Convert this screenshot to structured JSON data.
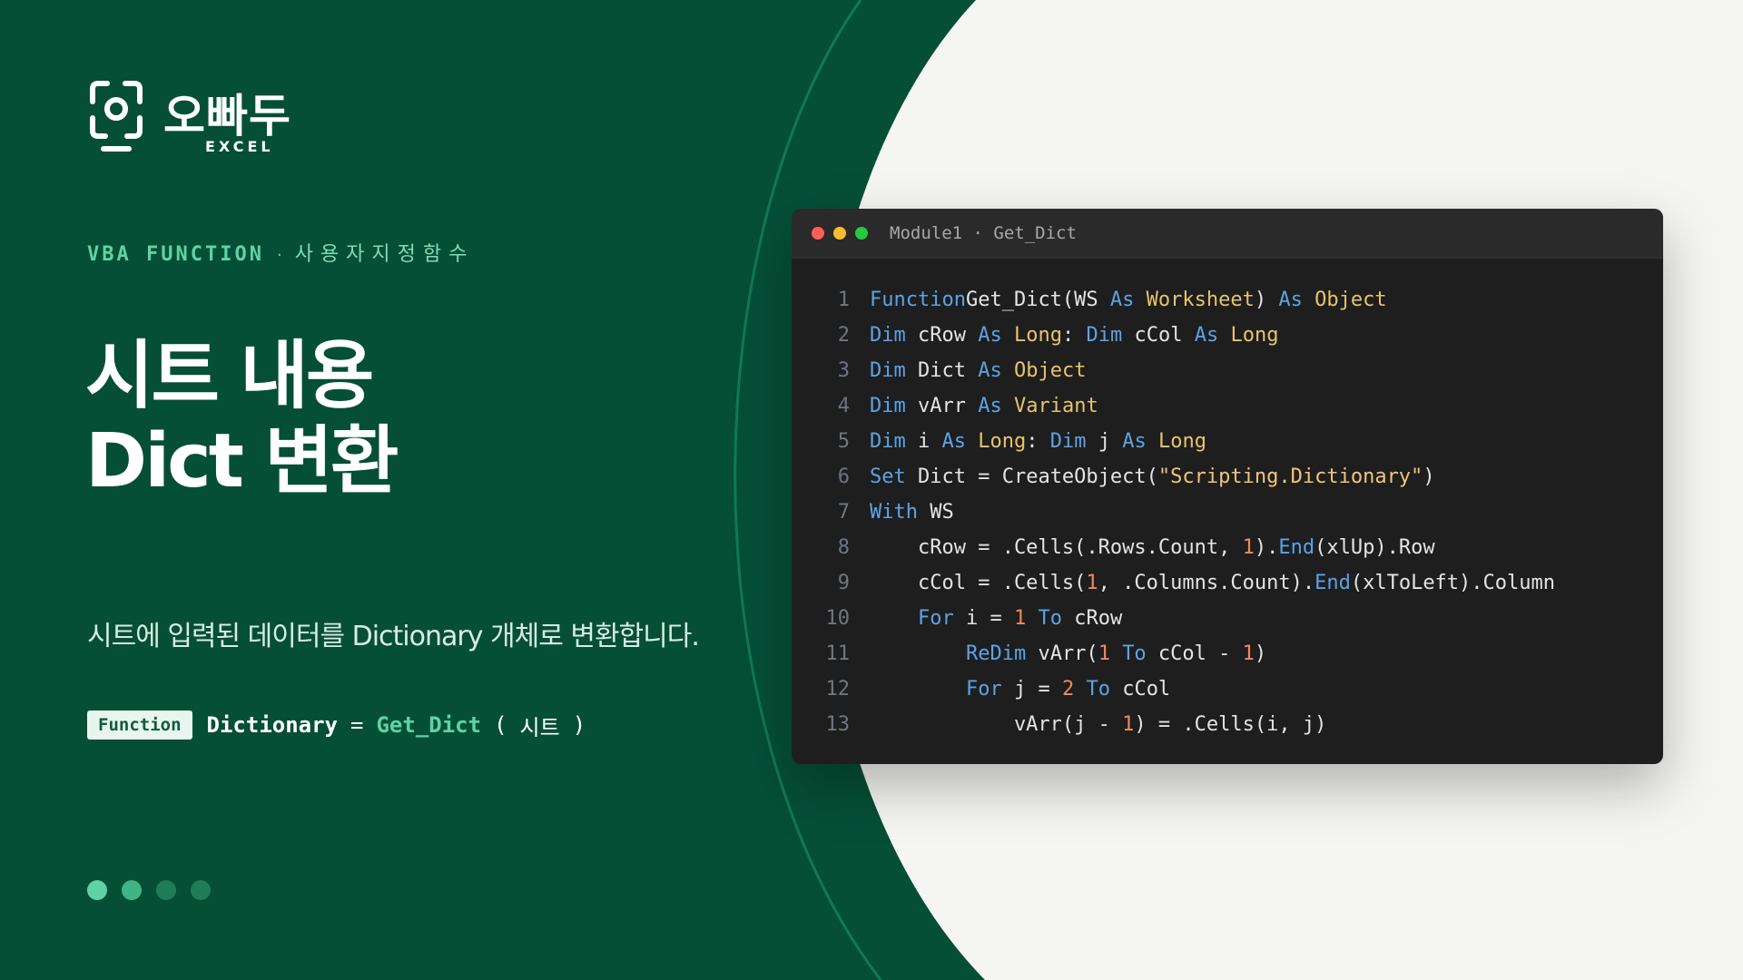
{
  "brand": {
    "name": "오빠두",
    "sub": "EXCEL"
  },
  "kicker": {
    "category": "VBA FUNCTION",
    "separator": "·",
    "subtitle": "사용자지정함수"
  },
  "title": {
    "line1": "시트 내용",
    "line2": "Dict 변환"
  },
  "description": "시트에 입력된 데이터를 Dictionary 개체로 변환합니다.",
  "syntax": {
    "badge": "Function",
    "result": "Dictionary",
    "equals": "=",
    "function_name": "Get_Dict",
    "open_paren": "(",
    "argument": "시트",
    "close_paren": ")"
  },
  "pagination": {
    "total": 4,
    "current": 2
  },
  "editor": {
    "title": "Module1 · Get_Dict",
    "lines": [
      {
        "n": "1",
        "parts": [
          [
            "kw",
            "Function"
          ],
          [
            "",
            "Get_Dict(WS "
          ],
          [
            "kw",
            "As"
          ],
          [
            "",
            " "
          ],
          [
            "ty",
            "Worksheet"
          ],
          [
            "",
            ") "
          ],
          [
            "kw",
            "As"
          ],
          [
            "",
            " "
          ],
          [
            "ty",
            "Object"
          ]
        ]
      },
      {
        "n": "2",
        "parts": [
          [
            "kw",
            "Dim"
          ],
          [
            "",
            " cRow "
          ],
          [
            "kw",
            "As"
          ],
          [
            "",
            " "
          ],
          [
            "ty",
            "Long"
          ],
          [
            "",
            ": "
          ],
          [
            "kw",
            "Dim"
          ],
          [
            "",
            " cCol "
          ],
          [
            "kw",
            "As"
          ],
          [
            "",
            " "
          ],
          [
            "ty",
            "Long"
          ]
        ]
      },
      {
        "n": "3",
        "parts": [
          [
            "kw",
            "Dim"
          ],
          [
            "",
            " Dict "
          ],
          [
            "kw",
            "As"
          ],
          [
            "",
            " "
          ],
          [
            "ty",
            "Object"
          ]
        ]
      },
      {
        "n": "4",
        "parts": [
          [
            "kw",
            "Dim"
          ],
          [
            "",
            " vArr "
          ],
          [
            "kw",
            "As"
          ],
          [
            "",
            " "
          ],
          [
            "ty",
            "Variant"
          ]
        ]
      },
      {
        "n": "5",
        "parts": [
          [
            "kw",
            "Dim"
          ],
          [
            "",
            " i "
          ],
          [
            "kw",
            "As"
          ],
          [
            "",
            " "
          ],
          [
            "ty",
            "Long"
          ],
          [
            "",
            ": "
          ],
          [
            "kw",
            "Dim"
          ],
          [
            "",
            " j "
          ],
          [
            "kw",
            "As"
          ],
          [
            "",
            " "
          ],
          [
            "ty",
            "Long"
          ]
        ]
      },
      {
        "n": "6",
        "parts": [
          [
            "kw",
            "Set"
          ],
          [
            "",
            " Dict = CreateObject("
          ],
          [
            "st",
            "\"Scripting.Dictionary\""
          ],
          [
            "",
            ")"
          ]
        ]
      },
      {
        "n": "7",
        "parts": [
          [
            "kw",
            "With"
          ],
          [
            "",
            " WS"
          ]
        ]
      },
      {
        "n": "8",
        "parts": [
          [
            "",
            "    cRow = .Cells(.Rows.Count, "
          ],
          [
            "nm",
            "1"
          ],
          [
            "",
            ")."
          ],
          [
            "kw",
            "End"
          ],
          [
            "",
            "(xlUp).Row"
          ]
        ]
      },
      {
        "n": "9",
        "parts": [
          [
            "",
            "    cCol = .Cells("
          ],
          [
            "nm",
            "1"
          ],
          [
            "",
            ", .Columns.Count)."
          ],
          [
            "kw",
            "End"
          ],
          [
            "",
            "(xlToLeft).Column"
          ]
        ]
      },
      {
        "n": "10",
        "parts": [
          [
            "",
            "    "
          ],
          [
            "kw",
            "For"
          ],
          [
            "",
            " i = "
          ],
          [
            "nm",
            "1"
          ],
          [
            "",
            " "
          ],
          [
            "kw",
            "To"
          ],
          [
            "",
            " cRow"
          ]
        ]
      },
      {
        "n": "11",
        "parts": [
          [
            "",
            "        "
          ],
          [
            "kw",
            "ReDim"
          ],
          [
            "",
            " vArr("
          ],
          [
            "nm",
            "1"
          ],
          [
            "",
            " "
          ],
          [
            "kw",
            "To"
          ],
          [
            "",
            " cCol - "
          ],
          [
            "nm",
            "1"
          ],
          [
            "",
            ")"
          ]
        ]
      },
      {
        "n": "12",
        "parts": [
          [
            "",
            "        "
          ],
          [
            "kw",
            "For"
          ],
          [
            "",
            " j = "
          ],
          [
            "nm",
            "2"
          ],
          [
            "",
            " "
          ],
          [
            "kw",
            "To"
          ],
          [
            "",
            " cCol"
          ]
        ]
      },
      {
        "n": "13",
        "parts": [
          [
            "",
            "            vArr(j - "
          ],
          [
            "nm",
            "1"
          ],
          [
            "",
            ") = .Cells(i, j)"
          ]
        ]
      }
    ]
  },
  "colors": {
    "panel": "#054f37",
    "accent": "#5fd3a4",
    "page": "#f5f5f3",
    "editor_bg": "#1e1e1e",
    "traffic": [
      "#ff5f57",
      "#febc2e",
      "#28c840"
    ],
    "dots": [
      "#5fd3a4",
      "#3fb585",
      "#1e7d57",
      "#1e7d57"
    ]
  }
}
